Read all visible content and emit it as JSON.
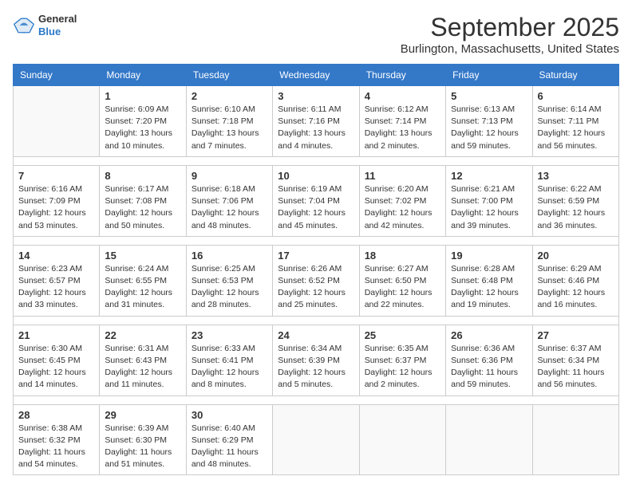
{
  "logo": {
    "line1": "General",
    "line2": "Blue"
  },
  "title": "September 2025",
  "location": "Burlington, Massachusetts, United States",
  "weekdays": [
    "Sunday",
    "Monday",
    "Tuesday",
    "Wednesday",
    "Thursday",
    "Friday",
    "Saturday"
  ],
  "weeks": [
    [
      {
        "day": "",
        "info": ""
      },
      {
        "day": "1",
        "info": "Sunrise: 6:09 AM\nSunset: 7:20 PM\nDaylight: 13 hours\nand 10 minutes."
      },
      {
        "day": "2",
        "info": "Sunrise: 6:10 AM\nSunset: 7:18 PM\nDaylight: 13 hours\nand 7 minutes."
      },
      {
        "day": "3",
        "info": "Sunrise: 6:11 AM\nSunset: 7:16 PM\nDaylight: 13 hours\nand 4 minutes."
      },
      {
        "day": "4",
        "info": "Sunrise: 6:12 AM\nSunset: 7:14 PM\nDaylight: 13 hours\nand 2 minutes."
      },
      {
        "day": "5",
        "info": "Sunrise: 6:13 AM\nSunset: 7:13 PM\nDaylight: 12 hours\nand 59 minutes."
      },
      {
        "day": "6",
        "info": "Sunrise: 6:14 AM\nSunset: 7:11 PM\nDaylight: 12 hours\nand 56 minutes."
      }
    ],
    [
      {
        "day": "7",
        "info": "Sunrise: 6:16 AM\nSunset: 7:09 PM\nDaylight: 12 hours\nand 53 minutes."
      },
      {
        "day": "8",
        "info": "Sunrise: 6:17 AM\nSunset: 7:08 PM\nDaylight: 12 hours\nand 50 minutes."
      },
      {
        "day": "9",
        "info": "Sunrise: 6:18 AM\nSunset: 7:06 PM\nDaylight: 12 hours\nand 48 minutes."
      },
      {
        "day": "10",
        "info": "Sunrise: 6:19 AM\nSunset: 7:04 PM\nDaylight: 12 hours\nand 45 minutes."
      },
      {
        "day": "11",
        "info": "Sunrise: 6:20 AM\nSunset: 7:02 PM\nDaylight: 12 hours\nand 42 minutes."
      },
      {
        "day": "12",
        "info": "Sunrise: 6:21 AM\nSunset: 7:00 PM\nDaylight: 12 hours\nand 39 minutes."
      },
      {
        "day": "13",
        "info": "Sunrise: 6:22 AM\nSunset: 6:59 PM\nDaylight: 12 hours\nand 36 minutes."
      }
    ],
    [
      {
        "day": "14",
        "info": "Sunrise: 6:23 AM\nSunset: 6:57 PM\nDaylight: 12 hours\nand 33 minutes."
      },
      {
        "day": "15",
        "info": "Sunrise: 6:24 AM\nSunset: 6:55 PM\nDaylight: 12 hours\nand 31 minutes."
      },
      {
        "day": "16",
        "info": "Sunrise: 6:25 AM\nSunset: 6:53 PM\nDaylight: 12 hours\nand 28 minutes."
      },
      {
        "day": "17",
        "info": "Sunrise: 6:26 AM\nSunset: 6:52 PM\nDaylight: 12 hours\nand 25 minutes."
      },
      {
        "day": "18",
        "info": "Sunrise: 6:27 AM\nSunset: 6:50 PM\nDaylight: 12 hours\nand 22 minutes."
      },
      {
        "day": "19",
        "info": "Sunrise: 6:28 AM\nSunset: 6:48 PM\nDaylight: 12 hours\nand 19 minutes."
      },
      {
        "day": "20",
        "info": "Sunrise: 6:29 AM\nSunset: 6:46 PM\nDaylight: 12 hours\nand 16 minutes."
      }
    ],
    [
      {
        "day": "21",
        "info": "Sunrise: 6:30 AM\nSunset: 6:45 PM\nDaylight: 12 hours\nand 14 minutes."
      },
      {
        "day": "22",
        "info": "Sunrise: 6:31 AM\nSunset: 6:43 PM\nDaylight: 12 hours\nand 11 minutes."
      },
      {
        "day": "23",
        "info": "Sunrise: 6:33 AM\nSunset: 6:41 PM\nDaylight: 12 hours\nand 8 minutes."
      },
      {
        "day": "24",
        "info": "Sunrise: 6:34 AM\nSunset: 6:39 PM\nDaylight: 12 hours\nand 5 minutes."
      },
      {
        "day": "25",
        "info": "Sunrise: 6:35 AM\nSunset: 6:37 PM\nDaylight: 12 hours\nand 2 minutes."
      },
      {
        "day": "26",
        "info": "Sunrise: 6:36 AM\nSunset: 6:36 PM\nDaylight: 11 hours\nand 59 minutes."
      },
      {
        "day": "27",
        "info": "Sunrise: 6:37 AM\nSunset: 6:34 PM\nDaylight: 11 hours\nand 56 minutes."
      }
    ],
    [
      {
        "day": "28",
        "info": "Sunrise: 6:38 AM\nSunset: 6:32 PM\nDaylight: 11 hours\nand 54 minutes."
      },
      {
        "day": "29",
        "info": "Sunrise: 6:39 AM\nSunset: 6:30 PM\nDaylight: 11 hours\nand 51 minutes."
      },
      {
        "day": "30",
        "info": "Sunrise: 6:40 AM\nSunset: 6:29 PM\nDaylight: 11 hours\nand 48 minutes."
      },
      {
        "day": "",
        "info": ""
      },
      {
        "day": "",
        "info": ""
      },
      {
        "day": "",
        "info": ""
      },
      {
        "day": "",
        "info": ""
      }
    ]
  ]
}
